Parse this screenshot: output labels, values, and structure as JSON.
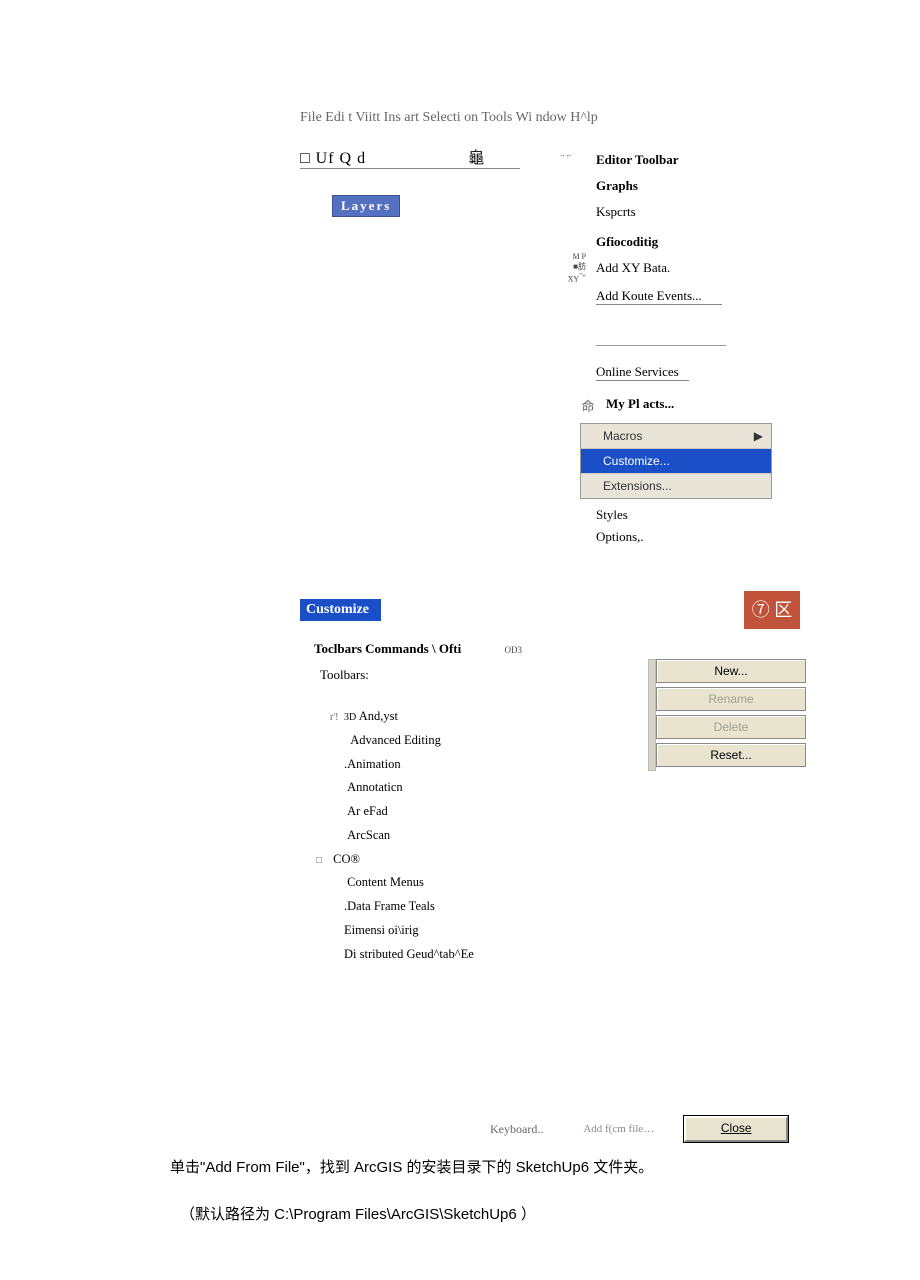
{
  "menubar": "File Edi t Viitt Ins art Selecti on Tools Wi ndow H^lp",
  "toolbar_text": "□ Uf Q d　　　　　　龜",
  "toolbar_dots": ".. ,.",
  "layers_badge": "Layers",
  "tools_menu": {
    "editor_toolbar": "Editor Toolbar",
    "graphs": "Graphs",
    "ksperts": "Kspcrts",
    "gfiocoditig": "Gfiocoditig",
    "add_xy": "Add XY Bata.",
    "add_koute": "Add Koute Events...",
    "online_services": "Online Services",
    "my_places": "My Pl acts...",
    "macros": "Macros",
    "customize": "Customize...",
    "extensions": "Extensions...",
    "styles": "Styles",
    "options": "Options,."
  },
  "xy_icons": {
    "mp": "M P",
    "xy": "■肪 XY"
  },
  "house_icon": "命",
  "customize_dialog": {
    "title": "Customize",
    "close_icon": "⑦ 区",
    "tabs": "Toclbars Commands \\ Ofti",
    "od3": "OD3",
    "toolbars_label": "Toolbars:",
    "list": [
      {
        "chk": "r'!",
        "label": "3D And,yst"
      },
      {
        "chk": "",
        "label": "Advanced Editing"
      },
      {
        "chk": "",
        "label": ".Animation"
      },
      {
        "chk": "",
        "label": "Annotaticn"
      },
      {
        "chk": "",
        "label": "Ar eFad"
      },
      {
        "chk": "",
        "label": "ArcScan"
      },
      {
        "chk": "□",
        "label": "CO®"
      },
      {
        "chk": "",
        "label": "Content Menus"
      },
      {
        "chk": "",
        "label": ".Data Frame Teals"
      },
      {
        "chk": "",
        "label": "Eimensi oi\\irig"
      },
      {
        "chk": "",
        "label": "Di stributed Geud^tab^Ee"
      }
    ],
    "buttons": {
      "new": "New...",
      "rename": "Rename",
      "delete": "Delete",
      "reset": "Reset..."
    },
    "keyboard": "Keyboard..",
    "add_from_file": "Add f(cm file…",
    "close": "Close"
  },
  "instruction1": "单击\"Add From File\"，找到 ArcGIS 的安装目录下的  SketchUp6 文件夹。",
  "instruction2": "（默认路径为  C:\\Program Files\\ArcGIS\\SketchUp6  ）"
}
